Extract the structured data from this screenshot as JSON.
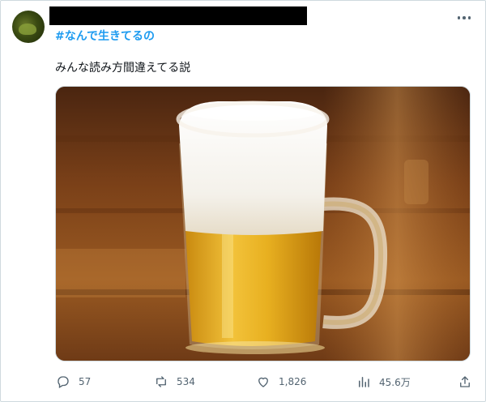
{
  "post": {
    "hashtag": "#なんで生きてるの",
    "text": "みんな読み方間違えてる説",
    "media_icon": "beer-mug-photo"
  },
  "actions": {
    "reply_count": "57",
    "repost_count": "534",
    "like_count": "1,826",
    "views_count": "45.6万"
  },
  "colors": {
    "hashtag": "#1d9bf0",
    "text": "#0f1419",
    "muted": "#536471",
    "border": "#cfd9de"
  }
}
